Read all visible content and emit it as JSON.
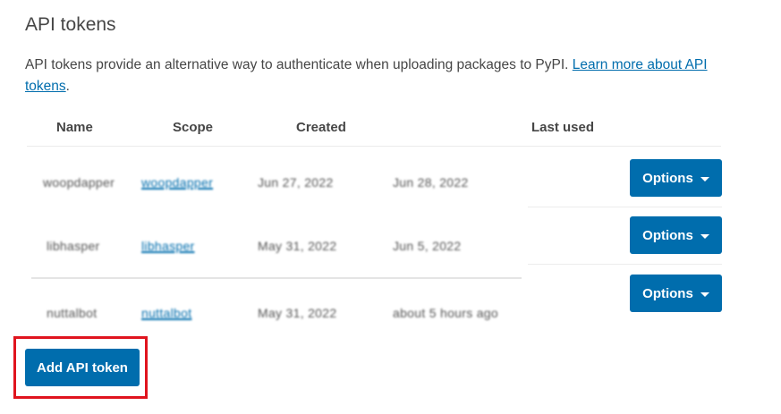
{
  "section": {
    "title": "API tokens",
    "description": "API tokens provide an alternative way to authenticate when uploading packages to PyPI. ",
    "learn_more_link": "Learn more about API tokens",
    "description_end": "."
  },
  "table": {
    "headers": [
      "Name",
      "Scope",
      "Created",
      "Last used"
    ],
    "rows": [
      {
        "name": "woopdapper",
        "scope": "woopdapper",
        "created": "Jun 27, 2022",
        "last_used": "Jun 28, 2022",
        "options_label": "Options"
      },
      {
        "name": "libhasper",
        "scope": "libhasper",
        "created": "May 31, 2022",
        "last_used": "Jun 5, 2022",
        "options_label": "Options"
      },
      {
        "name": "nuttalbot",
        "scope": "nuttalbot",
        "created": "May 31, 2022",
        "last_used": "about 5 hours ago",
        "options_label": "Options"
      }
    ]
  },
  "add_button_label": "Add API token",
  "colors": {
    "primary": "#006dad",
    "highlight": "#e0141e",
    "text": "#464646"
  }
}
